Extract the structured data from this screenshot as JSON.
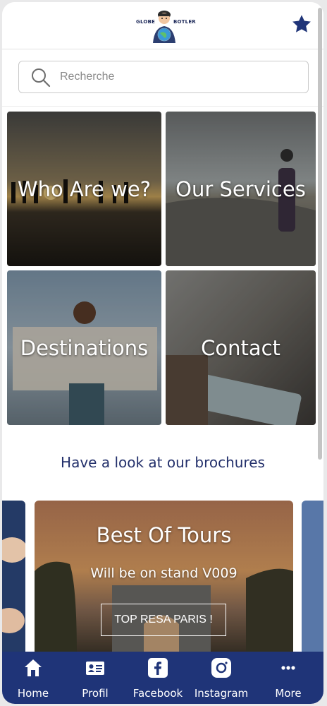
{
  "header": {
    "logo_left": "GLOBE",
    "logo_right": "BOTLER",
    "favorite_icon": "star-icon"
  },
  "search": {
    "placeholder": "Recherche",
    "value": ""
  },
  "tiles": [
    {
      "label": "Who Are we?"
    },
    {
      "label": "Our Services"
    },
    {
      "label": "Destinations"
    },
    {
      "label": "Contact"
    }
  ],
  "brochures": {
    "title": "Have a look at our brochures",
    "card": {
      "title": "Best Of Tours",
      "subtitle": "Will be on stand V009",
      "button_label": "TOP RESA PARIS !"
    }
  },
  "bottom_nav": [
    {
      "label": "Home",
      "icon": "home-icon"
    },
    {
      "label": "Profil",
      "icon": "profile-card-icon"
    },
    {
      "label": "Facebook",
      "icon": "facebook-icon"
    },
    {
      "label": "Instagram",
      "icon": "instagram-icon"
    },
    {
      "label": "More",
      "icon": "more-dots-icon"
    }
  ],
  "colors": {
    "brand_navy": "#1f3478",
    "title_blue": "#23306b",
    "star": "#1f3478"
  }
}
